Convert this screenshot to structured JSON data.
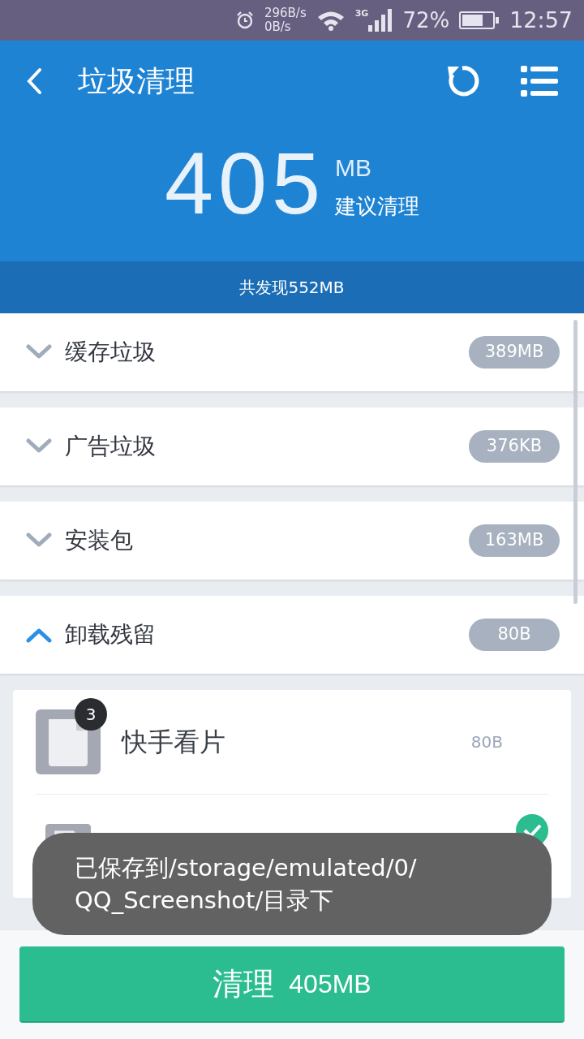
{
  "status_bar": {
    "net_up": "296B/s",
    "net_down": "0B/s",
    "network": "3G",
    "battery": "72%",
    "time": "12:57"
  },
  "header": {
    "title": "垃圾清理",
    "amount": "405",
    "unit": "MB",
    "hint": "建议清理",
    "found": "共发现552MB"
  },
  "categories": [
    {
      "name": "缓存垃圾",
      "size": "389MB",
      "expanded": false
    },
    {
      "name": "广告垃圾",
      "size": "376KB",
      "expanded": false
    },
    {
      "name": "安装包",
      "size": "163MB",
      "expanded": false
    },
    {
      "name": "卸载残留",
      "size": "80B",
      "expanded": true,
      "children": [
        {
          "kind": "app",
          "name": "快手看片",
          "size": "80B",
          "badge": "3"
        },
        {
          "kind": "sub",
          "checked": true
        }
      ]
    }
  ],
  "toast": "已保存到/storage/emulated/0/\nQQ_Screenshot/目录下",
  "clean_button": {
    "label": "清理",
    "size": "405MB"
  }
}
